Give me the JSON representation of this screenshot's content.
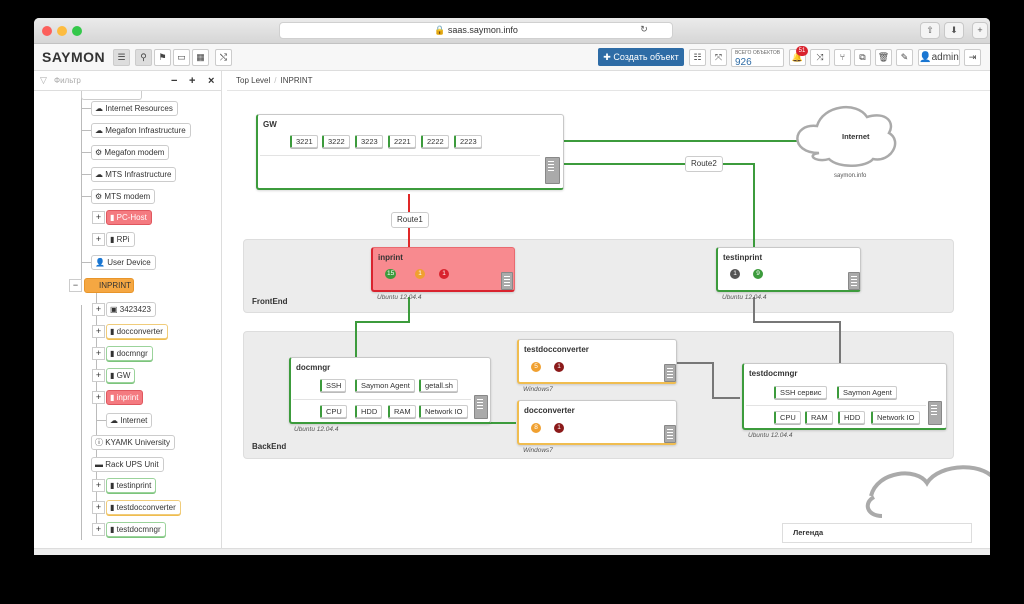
{
  "browser": {
    "url": "saas.saymon.info"
  },
  "app": {
    "logo": "SAYMON",
    "create_label": "Создать объект",
    "count_label": "ВСЕГО ОБЪЕКТОВ",
    "count_value": "926",
    "notif_count": "51",
    "user": "admin"
  },
  "sidebar": {
    "filter_placeholder": "Фильтр",
    "minus": "−",
    "plus": "+",
    "close": "×",
    "items": [
      {
        "label": "Internet Resources",
        "icon": "cloud-icon"
      },
      {
        "label": "Megafon Infrastructure",
        "icon": "cloud-icon"
      },
      {
        "label": "Megafon modem",
        "icon": "modem-icon"
      },
      {
        "label": "MTS Infrastructure",
        "icon": "cloud-icon"
      },
      {
        "label": "MTS modem",
        "icon": "modem-icon"
      },
      {
        "label": "PC-Host",
        "icon": "server-icon"
      },
      {
        "label": "RPi",
        "icon": "server-icon"
      },
      {
        "label": "User Device",
        "icon": "user-icon"
      },
      {
        "label": "INPRINT",
        "icon": "folder-icon"
      },
      {
        "label": "3423423",
        "icon": "app-icon"
      },
      {
        "label": "docconverter",
        "icon": "server-icon"
      },
      {
        "label": "docmngr",
        "icon": "server-icon"
      },
      {
        "label": "GW",
        "icon": "server-icon"
      },
      {
        "label": "inprint",
        "icon": "server-icon"
      },
      {
        "label": "Internet",
        "icon": "cloud-icon"
      },
      {
        "label": "KYAMK University",
        "icon": "info-icon"
      },
      {
        "label": "Rack UPS Unit",
        "icon": "ups-icon"
      },
      {
        "label": "testinprint",
        "icon": "server-icon"
      },
      {
        "label": "testdocconverter",
        "icon": "server-icon"
      },
      {
        "label": "testdocmngr",
        "icon": "server-icon"
      }
    ]
  },
  "breadcrumb": [
    "Top Level",
    "INPRINT"
  ],
  "map": {
    "groups": {
      "frontend": "FrontEnd",
      "backend": "BackEnd"
    },
    "gw": {
      "title": "GW",
      "chips": [
        "3221",
        "3222",
        "3223",
        "2221",
        "2222",
        "2223"
      ]
    },
    "internet": {
      "title": "Internet",
      "subtitle": "saymon.info"
    },
    "route1": "Route1",
    "route2": "Route2",
    "inprint": {
      "title": "inprint",
      "counts": [
        "15",
        "1",
        "1"
      ],
      "os": "Ubuntu 12.04.4"
    },
    "testinprint": {
      "title": "testinprint",
      "counts": [
        "1",
        "9"
      ],
      "os": "Ubuntu 12.04.4"
    },
    "docmngr": {
      "title": "docmngr",
      "row1": [
        "SSH",
        "Saymon Agent",
        "getall.sh"
      ],
      "row2": [
        "CPU",
        "HDD",
        "RAM",
        "Network IO"
      ],
      "os": "Ubuntu 12.04.4"
    },
    "testdocconverter": {
      "title": "testdocconverter",
      "counts": [
        "5",
        "1"
      ],
      "os": "Windows7"
    },
    "docconverter": {
      "title": "docconverter",
      "counts": [
        "8",
        "1"
      ],
      "os": "Windows7"
    },
    "testdocmngr": {
      "title": "testdocmngr",
      "row1": [
        "SSH сервис",
        "Saymon Agent"
      ],
      "row2": [
        "CPU",
        "RAM",
        "HDD",
        "Network IO"
      ],
      "os": "Ubuntu 12.04.4"
    },
    "legend": "Легенда"
  },
  "colors": {
    "green": "#3c9b3c",
    "red": "#d9232e",
    "blue": "#2e6ca6",
    "orange": "#f5a742"
  }
}
